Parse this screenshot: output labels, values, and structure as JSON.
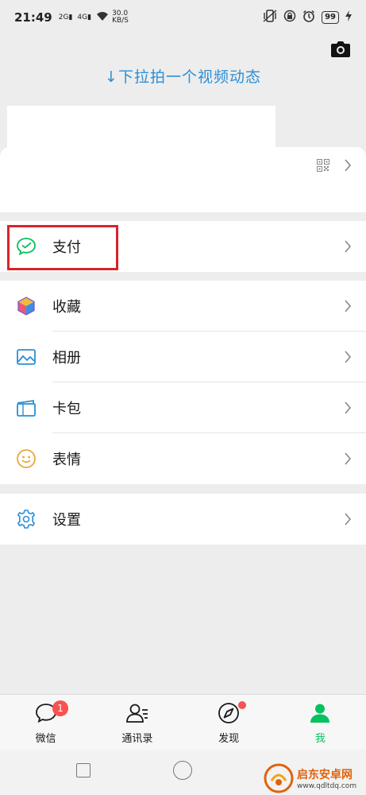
{
  "status_bar": {
    "time": "21:49",
    "signal1": "2G",
    "signal2": "4G",
    "net_speed_value": "30.0",
    "net_speed_unit": "KB/S",
    "battery": "99"
  },
  "pull_hint": "↓下拉拍一个视频动态",
  "menu": {
    "pay": "支付",
    "favorites": "收藏",
    "album": "相册",
    "cards": "卡包",
    "stickers": "表情",
    "settings": "设置"
  },
  "tabs": [
    {
      "label": "微信",
      "badge": "1"
    },
    {
      "label": "通讯录"
    },
    {
      "label": "发现"
    },
    {
      "label": "我"
    }
  ],
  "watermark": {
    "title": "启东安卓网",
    "url": "www.qdltdq.com"
  },
  "colors": {
    "accent_green": "#07c160",
    "hint_blue": "#2b8fd6",
    "highlight_red": "#d9242a",
    "badge_red": "#fa5151"
  }
}
